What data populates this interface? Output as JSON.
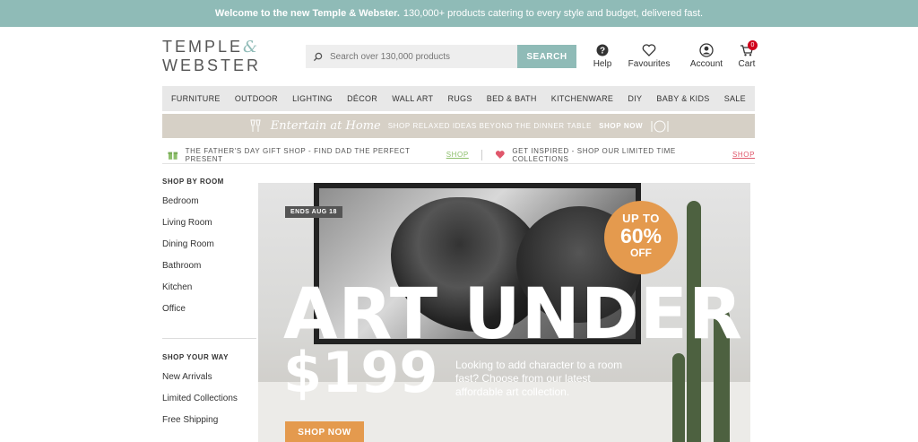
{
  "topbar": {
    "bold": "Welcome to the new Temple & Webster.",
    "text": "130,000+ products catering to every style and budget, delivered fast."
  },
  "logo": {
    "line1": "TEMPLE",
    "amp": "&",
    "line2": "WEBSTER"
  },
  "search": {
    "placeholder": "Search over 130,000 products",
    "button": "SEARCH"
  },
  "header_icons": [
    {
      "label": "Help"
    },
    {
      "label": "Favourites"
    },
    {
      "label": "Account"
    },
    {
      "label": "Cart",
      "count": "0"
    }
  ],
  "nav": [
    "FURNITURE",
    "OUTDOOR",
    "LIGHTING",
    "DÉCOR",
    "WALL ART",
    "RUGS",
    "BED & BATH",
    "KITCHENWARE",
    "DIY",
    "BABY & KIDS",
    "SALE"
  ],
  "promo": {
    "script": "Entertain at Home",
    "text": "SHOP RELAXED IDEAS BEYOND THE DINNER TABLE",
    "cta": "SHOP NOW"
  },
  "strip": {
    "left_text": "THE FATHER'S DAY GIFT SHOP - FIND DAD THE PERFECT PRESENT",
    "left_link": "SHOP",
    "right_text": "GET INSPIRED - SHOP OUR LIMITED TIME COLLECTIONS",
    "right_link": "SHOP"
  },
  "sidebar": {
    "room_heading": "SHOP BY ROOM",
    "rooms": [
      "Bedroom",
      "Living Room",
      "Dining Room",
      "Bathroom",
      "Kitchen",
      "Office"
    ],
    "way_heading": "SHOP YOUR WAY",
    "ways": [
      "New Arrivals",
      "Limited Collections",
      "Free Shipping"
    ]
  },
  "hero": {
    "ends": "ENDS AUG 18",
    "badge_top": "UP TO",
    "badge_pct": "60%",
    "badge_bottom": "OFF",
    "headline": "ART UNDER",
    "price": "$199",
    "subcopy": "Looking to add character to a room fast? Choose from our latest affordable art collection.",
    "cta": "SHOP NOW"
  },
  "colors": {
    "teal": "#8fbbb7",
    "orange": "#e49a4e"
  }
}
